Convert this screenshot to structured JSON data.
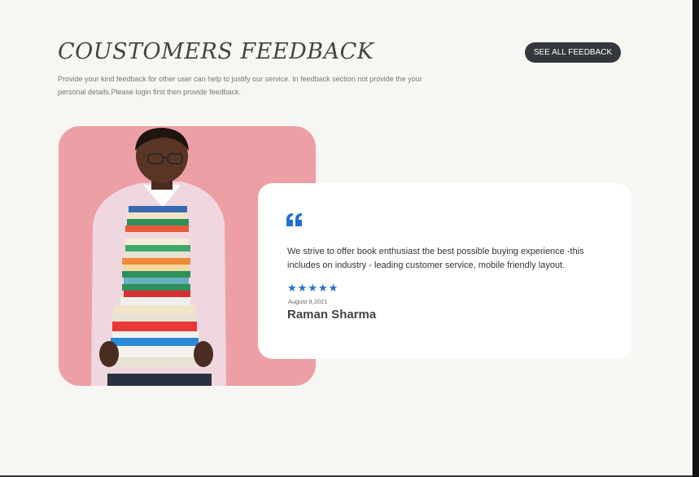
{
  "header": {
    "title": "COUSTOMERS FEEDBACK",
    "subtitle": "Provide your kind feedback for other user can help to justify our service. In feedback section not provide the your personal details.Please login first then provide feedback.",
    "see_all_label": "SEE ALL FEEDBACK"
  },
  "review": {
    "quote_icon": "quote-icon",
    "text": "We strive to offer book enthusiast the best possible buying experience -this includes on industry - leading customer service, mobile friendly layout.",
    "rating": 5,
    "rating_max": 5,
    "date": "August 9,2021",
    "author": "Raman Sharma"
  },
  "colors": {
    "background": "#f8f6f3",
    "photo_background": "#ed9fa6",
    "button_background": "#34383c",
    "star_color": "#1f6fd8",
    "card_background": "#ffffff"
  }
}
